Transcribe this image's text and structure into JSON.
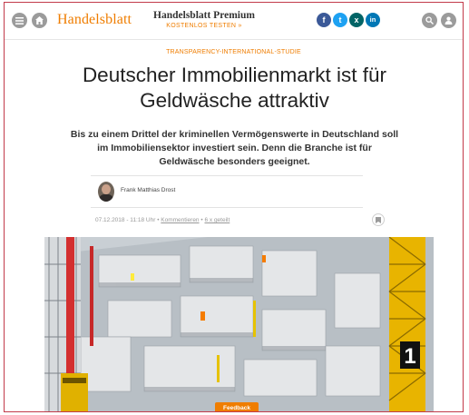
{
  "header": {
    "logo_text": "Handelsblatt",
    "premium_title": "Handelsblatt Premium",
    "premium_link": "KOSTENLOS TESTEN »",
    "menu_icon": "menu-icon",
    "home_icon": "home-icon",
    "search_icon": "search-icon",
    "user_icon": "user-icon",
    "social": [
      {
        "name": "facebook",
        "glyph": "f",
        "color": "#3b5998"
      },
      {
        "name": "twitter",
        "glyph": "t",
        "color": "#1da1f2"
      },
      {
        "name": "xing",
        "glyph": "x",
        "color": "#026466"
      },
      {
        "name": "linkedin",
        "glyph": "in",
        "color": "#0077b5"
      }
    ]
  },
  "article": {
    "kicker": "TRANSPARENCY-INTERNATIONAL-STUDIE",
    "headline": "Deutscher Immobilienmarkt ist für Geldwäsche attraktiv",
    "lead": "Bis zu einem Drittel der kriminellen Vermögenswerte in Deutschland soll im Immobiliensektor investiert sein. Denn die Branche ist für Geldwäsche besonders geeignet.",
    "author": "Frank Matthias Drost",
    "date": "07.12.2018 - 11:18 Uhr",
    "separator": "•",
    "comments_link": "Kommentieren",
    "shares": "6 x geteilt",
    "image_label": "1"
  },
  "feedback_label": "Feedback",
  "colors": {
    "accent": "#ef7d00",
    "frame": "#c23a4a",
    "icon_gray": "#9b9b9b"
  }
}
